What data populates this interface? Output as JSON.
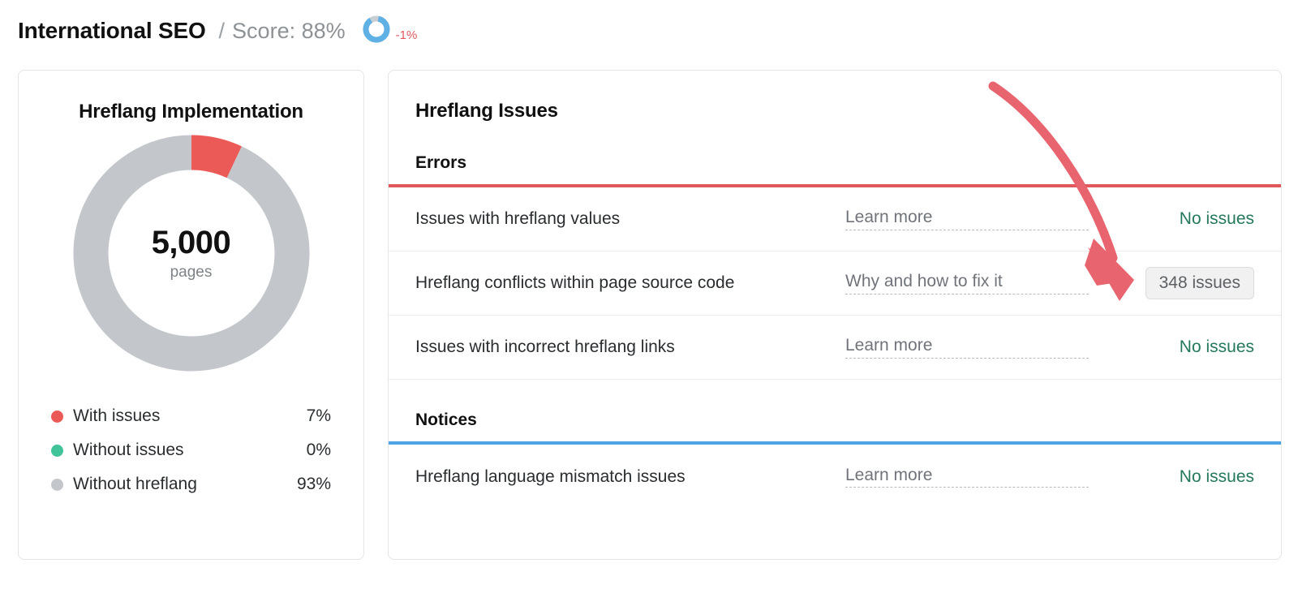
{
  "header": {
    "title": "International SEO",
    "separator": "/",
    "score_label": "Score: 88%",
    "delta": "-1%",
    "score_value": 88,
    "donut_icon": "score-donut-icon"
  },
  "left_card": {
    "title": "Hreflang Implementation",
    "donut_center_value": "5,000",
    "donut_center_unit": "pages",
    "legend": [
      {
        "label": "With issues",
        "value": "7%",
        "color": "#ec5a57"
      },
      {
        "label": "Without issues",
        "value": "0%",
        "color": "#41c49a"
      },
      {
        "label": "Without hreflang",
        "value": "93%",
        "color": "#c3c7cb"
      }
    ]
  },
  "right_card": {
    "title": "Hreflang Issues",
    "sections": [
      {
        "heading": "Errors",
        "bar_color": "#e2585d",
        "rows": [
          {
            "name": "Issues with hreflang values",
            "link": "Learn more",
            "status": "No issues",
            "status_type": "ok"
          },
          {
            "name": "Hreflang conflicts within page source code",
            "link": "Why and how to fix it",
            "status": "348 issues",
            "status_type": "pill"
          },
          {
            "name": "Issues with incorrect hreflang links",
            "link": "Learn more",
            "status": "No issues",
            "status_type": "ok"
          }
        ]
      },
      {
        "heading": "Notices",
        "bar_color": "#4fa3e3",
        "rows": [
          {
            "name": "Hreflang language mismatch issues",
            "link": "Learn more",
            "status": "No issues",
            "status_type": "ok"
          }
        ]
      }
    ]
  },
  "annotation": {
    "arrow_color": "#e8656f",
    "arrow_name": "callout-arrow"
  },
  "chart_data": {
    "type": "pie",
    "title": "Hreflang Implementation",
    "center_label": "5,000",
    "center_sublabel": "pages",
    "total": 5000,
    "categories": [
      "With issues",
      "Without issues",
      "Without hreflang"
    ],
    "values": [
      7,
      0,
      93
    ],
    "value_unit": "%",
    "colors": [
      "#ec5a57",
      "#41c49a",
      "#c3c7cb"
    ],
    "legend_position": "bottom",
    "start_angle": 0,
    "donut": true
  }
}
